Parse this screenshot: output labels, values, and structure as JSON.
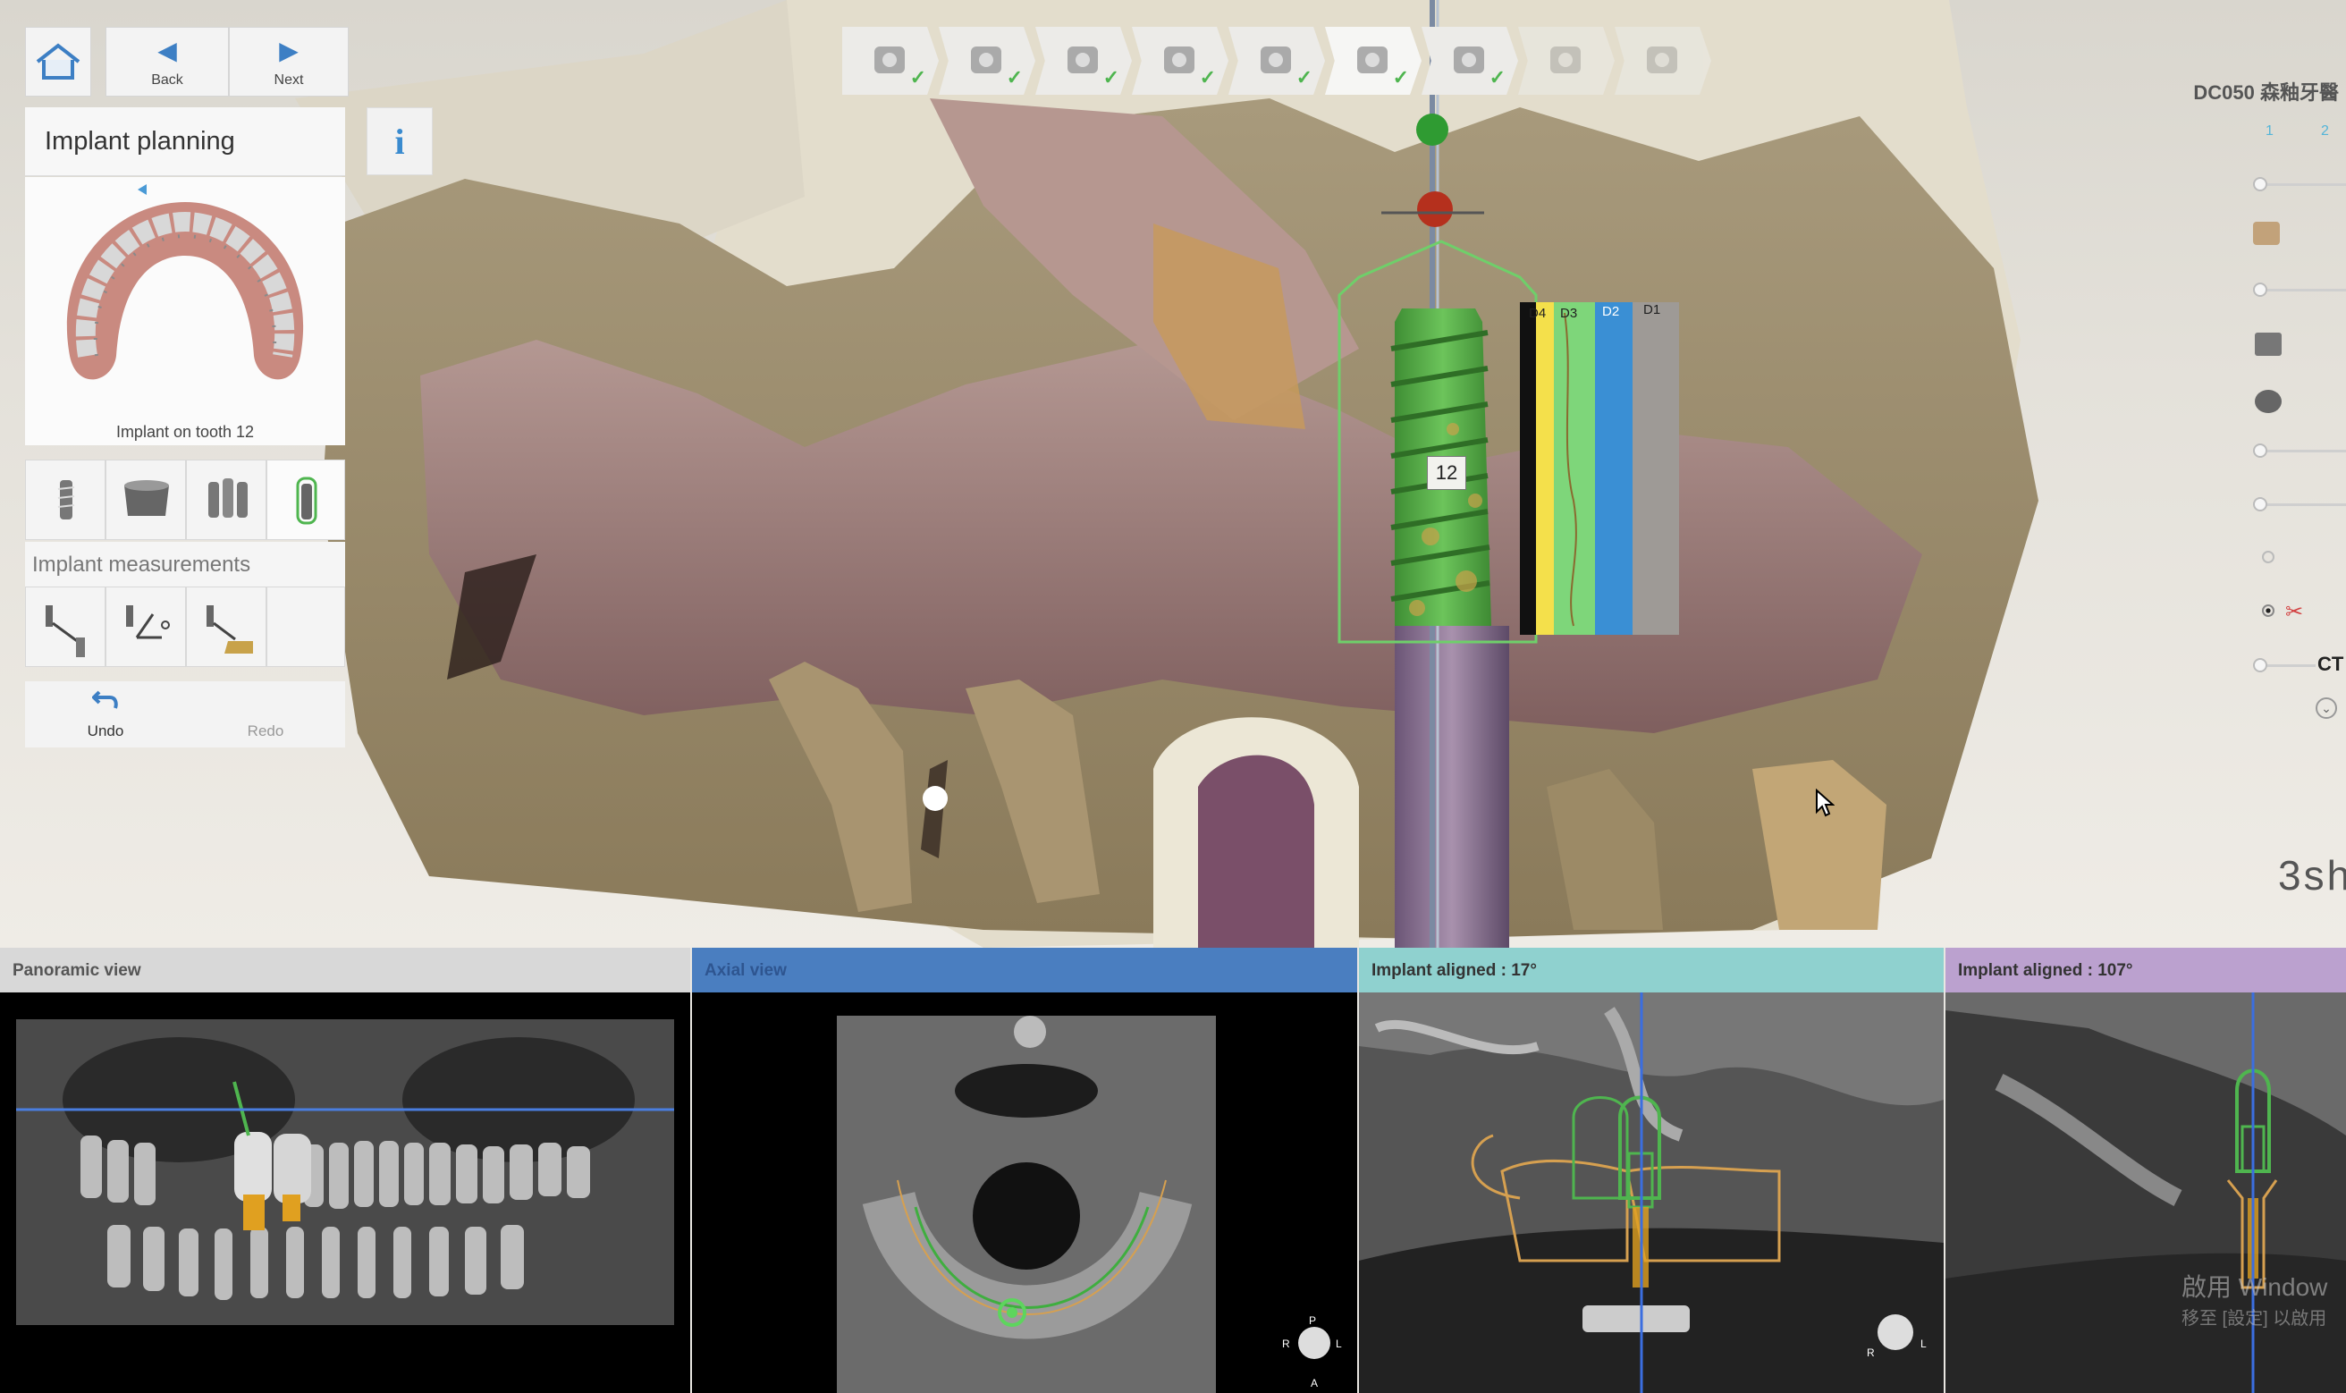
{
  "nav": {
    "back": "Back",
    "next": "Next"
  },
  "panel": {
    "title": "Implant planning",
    "info_glyph": "i",
    "arch_caption": "Implant on tooth 12",
    "measurements_label": "Implant measurements",
    "undo": "Undo",
    "redo": "Redo"
  },
  "workflow": [
    {
      "icon": "prescription-icon",
      "done": true
    },
    {
      "icon": "scan-import-icon",
      "done": true
    },
    {
      "icon": "segmentation-icon",
      "done": true
    },
    {
      "icon": "crown-icon",
      "done": true
    },
    {
      "icon": "jaw-icon",
      "done": true
    },
    {
      "icon": "implant-icon",
      "done": true,
      "active": true
    },
    {
      "icon": "sleeve-icon",
      "done": true
    },
    {
      "icon": "guide-tool-icon",
      "done": false
    },
    {
      "icon": "guide-output-icon",
      "done": false
    }
  ],
  "right": {
    "site_label": "DC050 森釉牙醫",
    "tab_numbers": [
      "1",
      "2"
    ],
    "ct_label": "CT",
    "brand": "3sh"
  },
  "implant": {
    "tooth_label": "12",
    "density_labels": [
      "D4",
      "D3",
      "D2",
      "D1"
    ]
  },
  "views": [
    {
      "title": "Panoramic view"
    },
    {
      "title": "Axial view"
    },
    {
      "title": "Implant aligned : 17°"
    },
    {
      "title": "Implant aligned : 107°"
    }
  ],
  "orientation": {
    "axial": [
      "P",
      "R",
      "L",
      "A"
    ],
    "aligned": [
      "R",
      "L"
    ]
  },
  "watermark": {
    "line1": "啟用 Window",
    "line2": "移至 [設定] 以啟用"
  },
  "colors": {
    "accent": "#3d7fc4",
    "check": "#4fb54f",
    "implant": "#5fb14a",
    "guide": "#5db04a"
  }
}
